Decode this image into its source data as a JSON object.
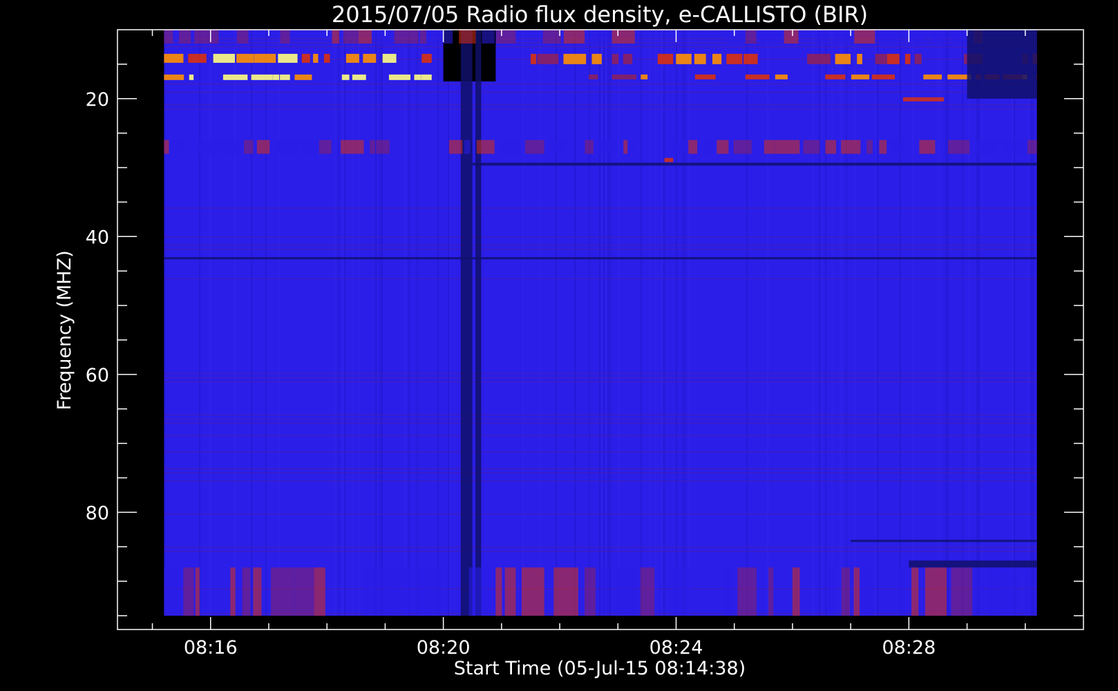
{
  "chart_data": {
    "type": "heatmap",
    "title": "2015/07/05  Radio flux density, e-CALLISTO (BIR)",
    "xlabel": "Start Time (05-Jul-15 08:14:38)",
    "ylabel": "Frequency (MHZ)",
    "x_range_minutes": [
      14.4,
      31.0
    ],
    "data_extent_minutes": [
      15.2,
      30.2
    ],
    "ylim": [
      97,
      10
    ],
    "data_extent_mhz": [
      10,
      95
    ],
    "x_ticks": [
      {
        "minute": 16,
        "label": "08:16"
      },
      {
        "minute": 20,
        "label": "08:20"
      },
      {
        "minute": 24,
        "label": "08:24"
      },
      {
        "minute": 28,
        "label": "08:28"
      }
    ],
    "x_minor_ticks": [
      15,
      17,
      18,
      19,
      21,
      22,
      23,
      25,
      26,
      27,
      29,
      30
    ],
    "y_ticks": [
      {
        "mhz": 20,
        "label": "20"
      },
      {
        "mhz": 40,
        "label": "40"
      },
      {
        "mhz": 60,
        "label": "60"
      },
      {
        "mhz": 80,
        "label": "80"
      }
    ],
    "y_minor_ticks": [
      15,
      25,
      30,
      35,
      45,
      50,
      55,
      65,
      70,
      75,
      85,
      90,
      95
    ],
    "background_color": "#2a1ee8",
    "colormap": [
      "#000000",
      "#10106a",
      "#2a1ee8",
      "#8a2060",
      "#d83010",
      "#ff9000",
      "#ffff80"
    ],
    "features": [
      {
        "kind": "dark_band",
        "t": [
          20.0,
          20.9
        ],
        "f": [
          10,
          17.5
        ],
        "level": 0
      },
      {
        "kind": "dark_stripe",
        "t": [
          20.3,
          20.5
        ],
        "f": [
          10,
          95
        ],
        "level": 1
      },
      {
        "kind": "dark_stripe",
        "t": [
          20.55,
          20.65
        ],
        "f": [
          10,
          95
        ],
        "level": 1
      },
      {
        "kind": "bright_band",
        "t": [
          15.2,
          19.8
        ],
        "f": [
          13.5,
          14.8
        ],
        "level": 5
      },
      {
        "kind": "bright_band",
        "t": [
          15.2,
          19.8
        ],
        "f": [
          16.5,
          17.3
        ],
        "level": 6
      },
      {
        "kind": "bright_band",
        "t": [
          21.5,
          30.2
        ],
        "f": [
          13.5,
          15.0
        ],
        "level": 4
      },
      {
        "kind": "bright_band",
        "t": [
          22.5,
          30.2
        ],
        "f": [
          16.5,
          17.2
        ],
        "level": 4
      },
      {
        "kind": "red_band",
        "t": [
          15.2,
          30.2
        ],
        "f": [
          26.0,
          28.0
        ],
        "level": 3
      },
      {
        "kind": "red_band",
        "t": [
          15.2,
          30.2
        ],
        "f": [
          10,
          12
        ],
        "level": 3
      },
      {
        "kind": "dark_line",
        "t": [
          20.5,
          30.2
        ],
        "f": [
          29.3,
          29.7
        ],
        "level": 1
      },
      {
        "kind": "dark_line",
        "t": [
          15.2,
          30.2
        ],
        "f": [
          43.0,
          43.3
        ],
        "level": 1
      },
      {
        "kind": "dark_line",
        "t": [
          27.0,
          30.2
        ],
        "f": [
          84.0,
          84.3
        ],
        "level": 1
      },
      {
        "kind": "red_band",
        "t": [
          15.2,
          30.2
        ],
        "f": [
          88.0,
          95.0
        ],
        "level": 3
      },
      {
        "kind": "dark_line",
        "t": [
          28.0,
          30.2
        ],
        "f": [
          87.0,
          88.0
        ],
        "level": 1
      },
      {
        "kind": "dark_block",
        "t": [
          29.0,
          30.2
        ],
        "f": [
          10,
          20
        ],
        "level": 1
      },
      {
        "kind": "bright_spot",
        "t": [
          27.9,
          28.6
        ],
        "f": [
          19.8,
          20.4
        ],
        "level": 4
      },
      {
        "kind": "bright_spot",
        "t": [
          23.8,
          23.95
        ],
        "f": [
          28.6,
          29.2
        ],
        "level": 4
      }
    ]
  }
}
